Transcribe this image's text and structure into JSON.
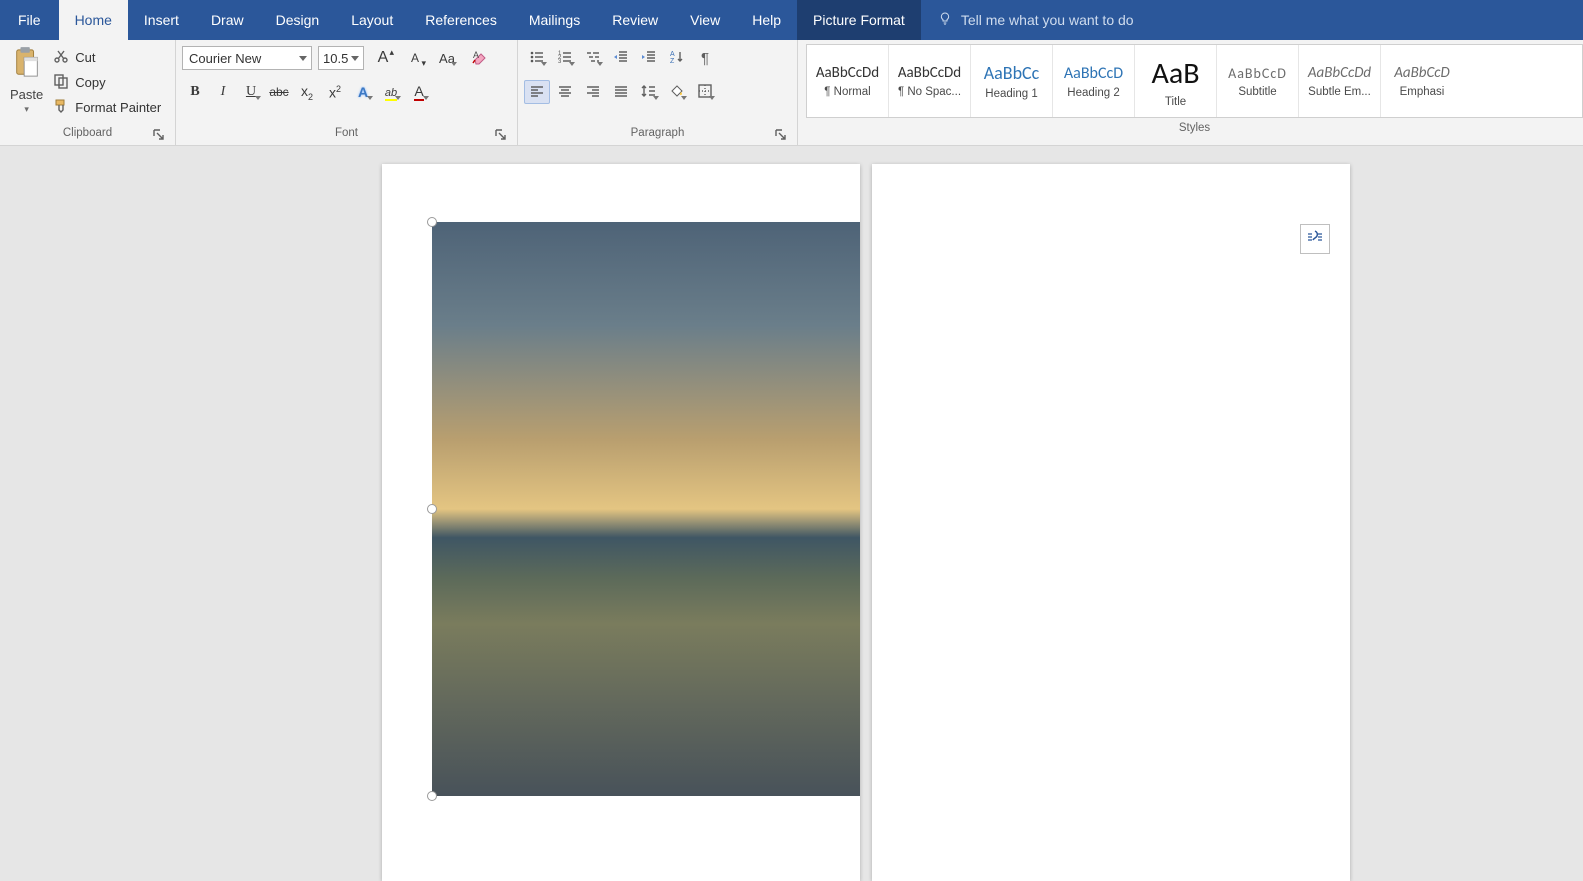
{
  "tabs": {
    "file": "File",
    "home": "Home",
    "insert": "Insert",
    "draw": "Draw",
    "design": "Design",
    "layout": "Layout",
    "references": "References",
    "mailings": "Mailings",
    "review": "Review",
    "view": "View",
    "help": "Help",
    "picture_format": "Picture Format"
  },
  "tellme": {
    "placeholder": "Tell me what you want to do"
  },
  "clipboard": {
    "label": "Clipboard",
    "paste": "Paste",
    "cut": "Cut",
    "copy": "Copy",
    "format_painter": "Format Painter"
  },
  "font": {
    "label": "Font",
    "name": "Courier New",
    "size": "10.5",
    "grow": "A",
    "shrink": "A",
    "change_case": "Aa",
    "bold": "B",
    "italic": "I",
    "underline": "U",
    "strike": "abc",
    "subscript": "x",
    "sub_sub": "2",
    "superscript": "x",
    "sup_sup": "2",
    "text_effect": "A",
    "highlight": "ab",
    "font_color": "A",
    "highlight_color": "#ffff00",
    "font_color_value": "#c00000"
  },
  "paragraph": {
    "label": "Paragraph"
  },
  "styles": {
    "label": "Styles",
    "items": [
      {
        "preview": "AaBbCcDd",
        "name": "¶ Normal",
        "variant": "normal"
      },
      {
        "preview": "AaBbCcDd",
        "name": "¶ No Spac...",
        "variant": "normal"
      },
      {
        "preview": "AaBbCc",
        "name": "Heading 1",
        "variant": "heading"
      },
      {
        "preview": "AaBbCcD",
        "name": "Heading 2",
        "variant": "heading"
      },
      {
        "preview": "AaB",
        "name": "Title",
        "variant": "title"
      },
      {
        "preview": "AaBbCcD",
        "name": "Subtitle",
        "variant": "sub"
      },
      {
        "preview": "AaBbCcDd",
        "name": "Subtle Em...",
        "variant": "em"
      },
      {
        "preview": "AaBbCcD",
        "name": "Emphasi",
        "variant": "em"
      }
    ]
  }
}
